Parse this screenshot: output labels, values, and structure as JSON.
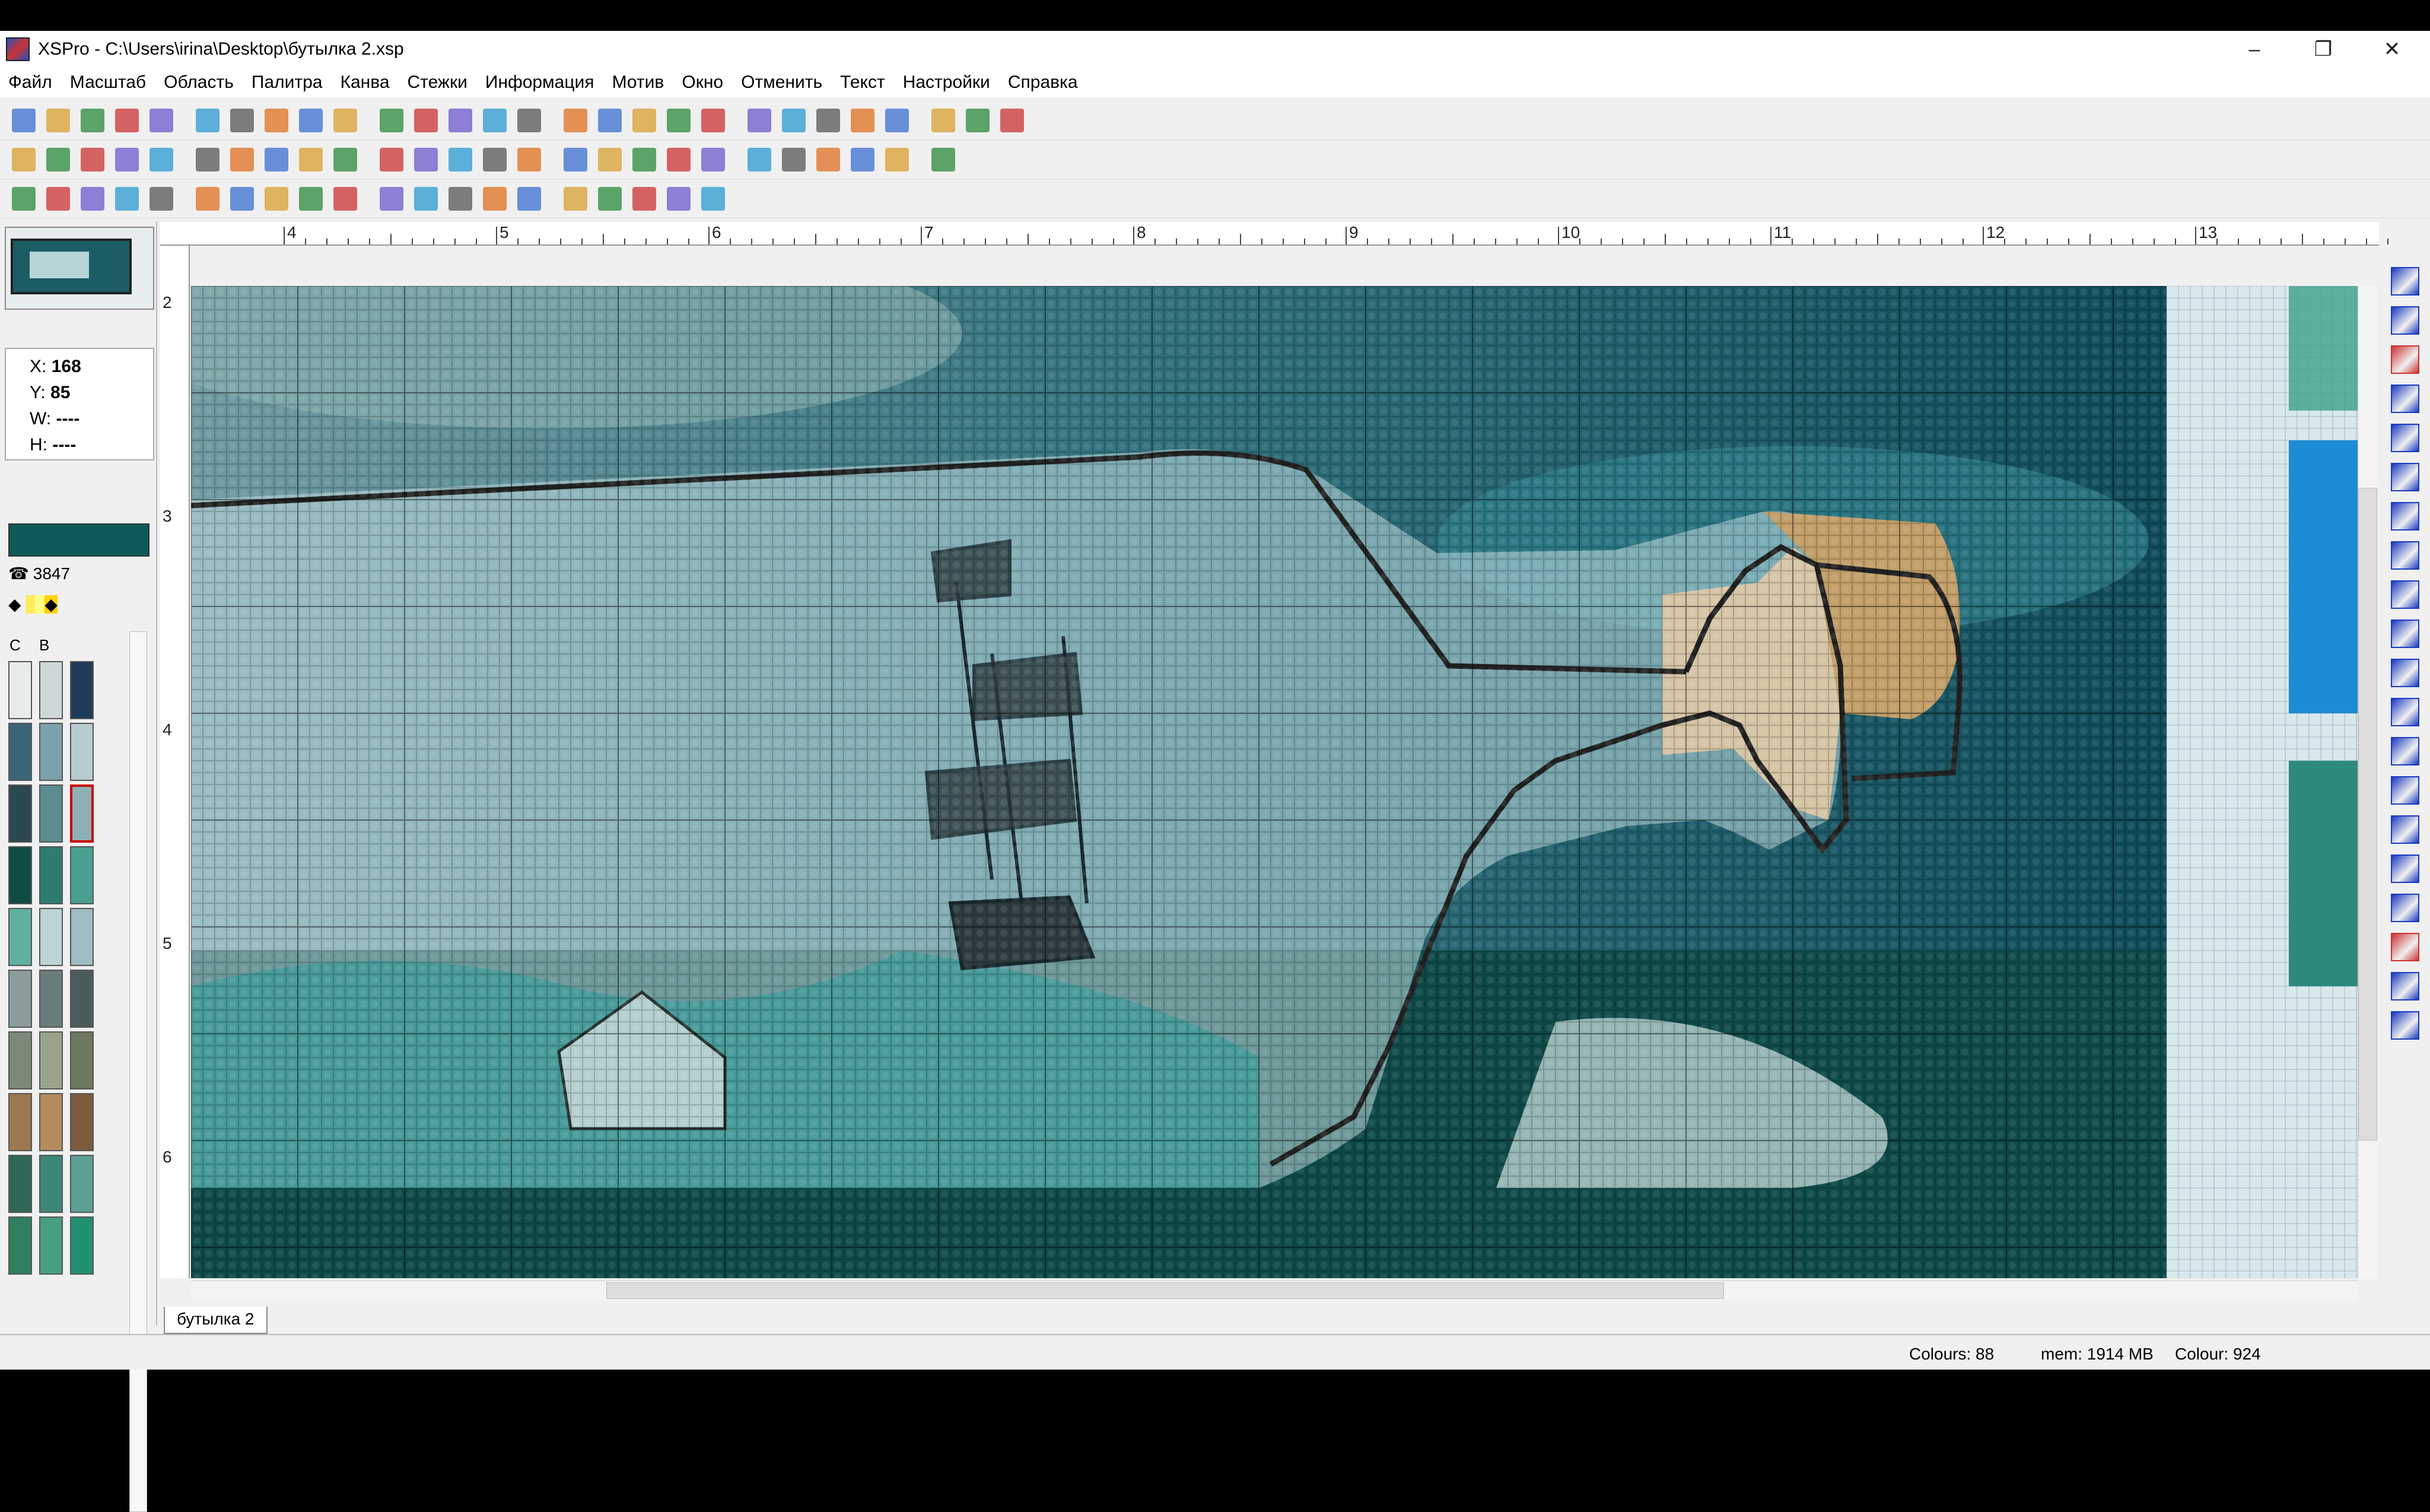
{
  "window": {
    "title": "XSPro - C:\\Users\\irina\\Desktop\\бутылка 2.xsp",
    "minimize": "–",
    "restore": "❐",
    "close": "✕"
  },
  "menu": [
    "Файл",
    "Масштаб",
    "Область",
    "Палитра",
    "Канва",
    "Стежки",
    "Информация",
    "Мотив",
    "Окно",
    "Отменить",
    "Текст",
    "Настройки",
    "Справка"
  ],
  "ruler": {
    "top_labels": [
      "4",
      "5",
      "6",
      "7",
      "8",
      "9",
      "10",
      "11",
      "12",
      "13"
    ],
    "left_labels": [
      "2",
      "3",
      "4",
      "5",
      "6"
    ]
  },
  "coords": {
    "x_label": "X:",
    "x": "168",
    "y_label": "Y:",
    "y": "85",
    "w_label": "W:",
    "w": "----",
    "h_label": "H:",
    "h": "----"
  },
  "color_panel": {
    "current_color": "#0d5a58",
    "code": "3847",
    "tab_c": "C",
    "tab_b": "B"
  },
  "palette": [
    "#e8ece8",
    "#cfd8d8",
    "#1e3c5a",
    "#3c6478",
    "#7ca0ac",
    "#b8ccd0",
    "#2c4850",
    "#5a8c90",
    "#8cb0b4",
    "#0e4c44",
    "#2e7c70",
    "#4aa090",
    "#60b0a0",
    "#bcd4d4",
    "#a0bcc4",
    "#8c9c9c",
    "#6a7c7c",
    "#4c5c5c",
    "#7c8878",
    "#9aa48c",
    "#6c7860",
    "#9c7850",
    "#b48c5c",
    "#7c5c3c",
    "#2e6858",
    "#3c8878",
    "#5ca094",
    "#308060",
    "#48a080",
    "#209070"
  ],
  "document_tab": "бутылка 2",
  "status": {
    "colours": "Colours: 88",
    "mem": "mem: 1914 MB",
    "colour": "Colour: 924"
  }
}
